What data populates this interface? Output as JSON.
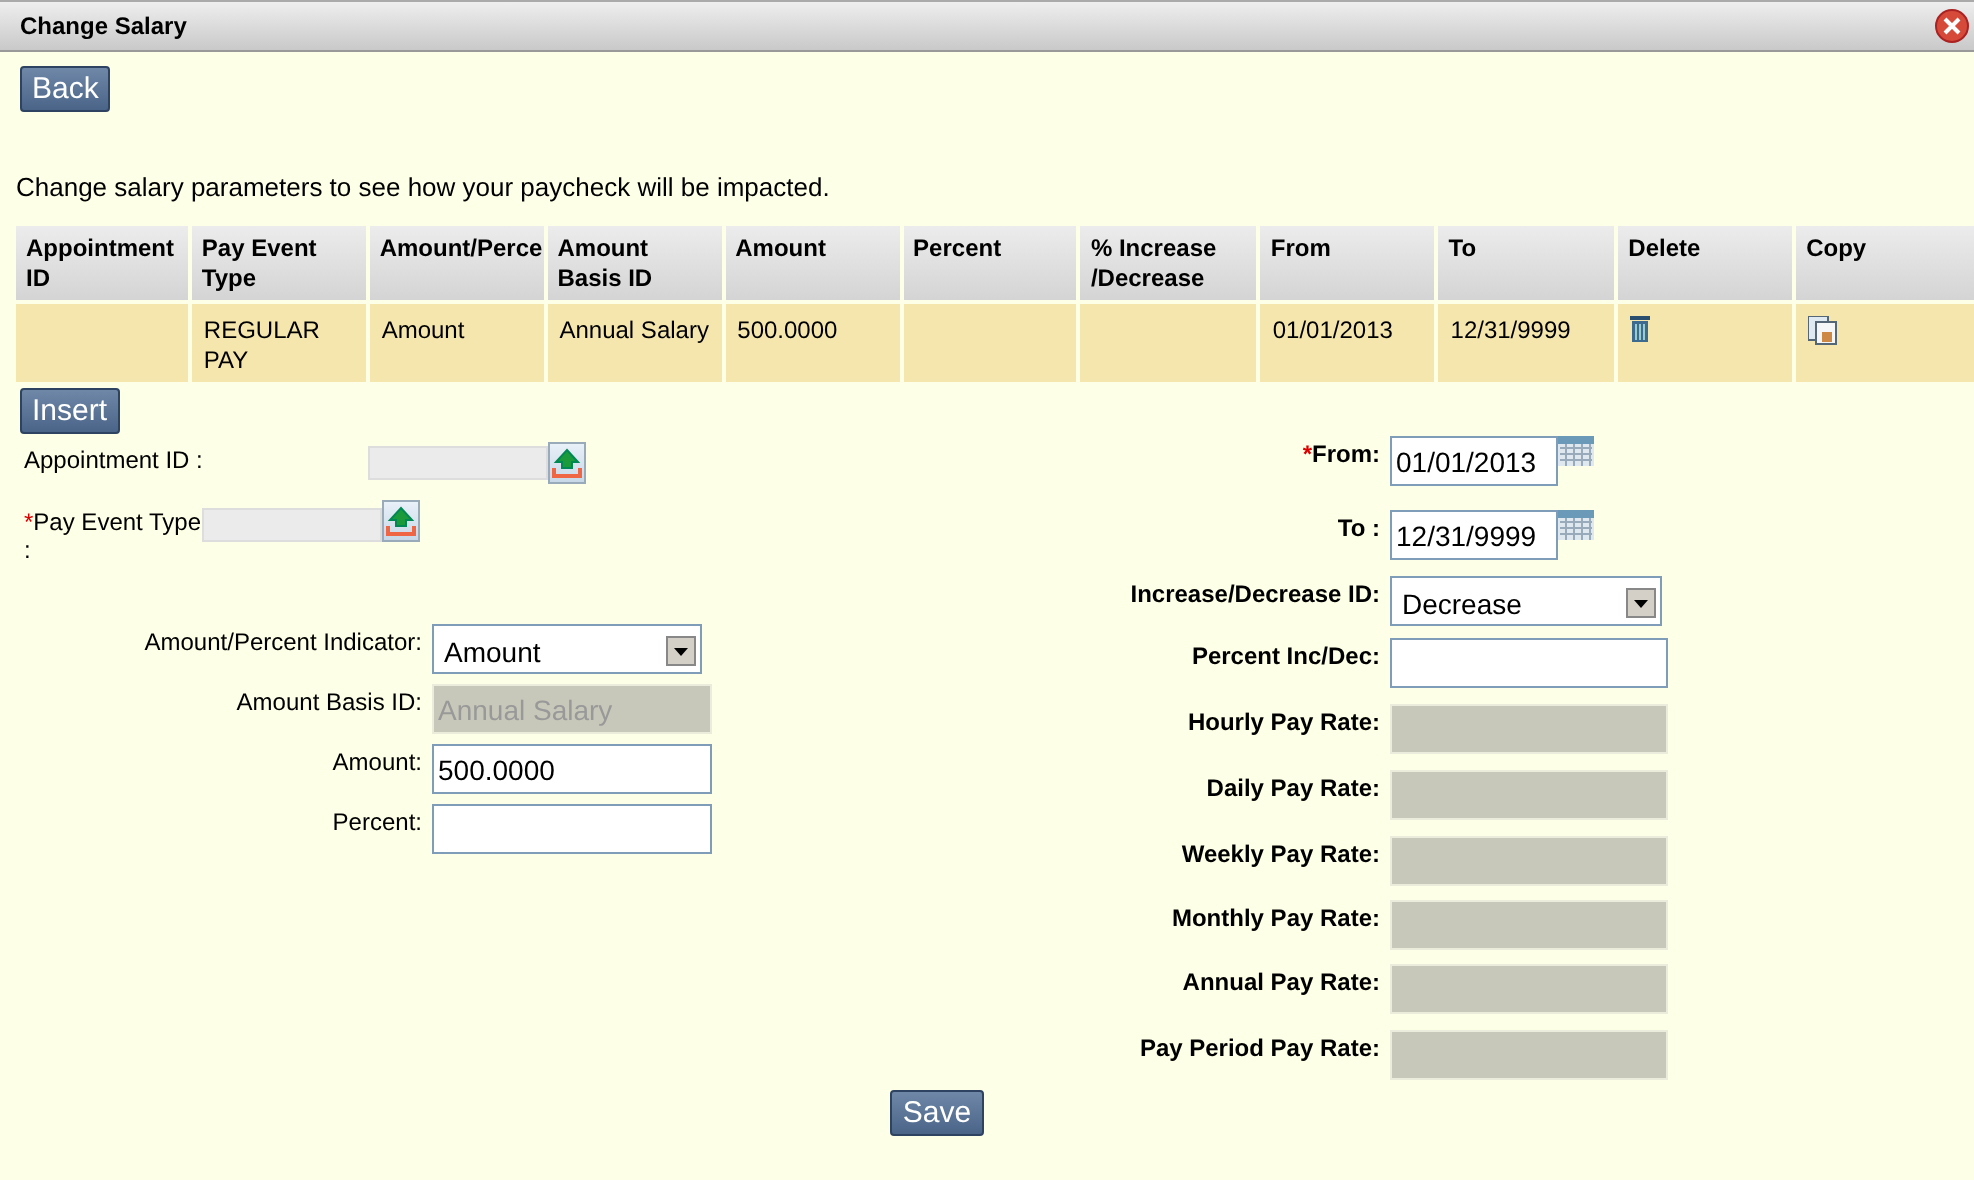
{
  "window": {
    "title": "Change Salary"
  },
  "back_button": "Back",
  "description": "Change salary parameters to see how your paycheck will be impacted.",
  "table": {
    "columns": [
      "Appointment ID",
      "Pay Event Type",
      "Amount/Perce",
      "Amount Basis ID",
      "Amount",
      "Percent",
      "% Increase /Decrease",
      "From",
      "To",
      "Delete",
      "Copy"
    ],
    "rows": [
      {
        "cells": [
          {
            "kind": "text",
            "text": ""
          },
          {
            "kind": "text",
            "text": "REGULAR PAY"
          },
          {
            "kind": "text",
            "text": "Amount"
          },
          {
            "kind": "text",
            "text": "Annual Salary"
          },
          {
            "kind": "text",
            "text": "500.0000"
          },
          {
            "kind": "text",
            "text": ""
          },
          {
            "kind": "text",
            "text": ""
          },
          {
            "kind": "text",
            "text": "01/01/2013"
          },
          {
            "kind": "text",
            "text": "12/31/9999"
          },
          {
            "kind": "delete"
          },
          {
            "kind": "copy"
          }
        ]
      }
    ]
  },
  "insert_button": "Insert",
  "left_form": [
    {
      "kind": "lookup",
      "label": "Appointment ID :"
    },
    {
      "kind": "lookup",
      "label": "Pay Event Type :",
      "marker": "*"
    },
    {
      "kind": "select",
      "label": "Amount/Percent Indicator:",
      "value": "Amount"
    },
    {
      "kind": "text",
      "label": "Amount Basis ID:",
      "placeholder": "Annual Salary",
      "disabled": true
    },
    {
      "kind": "text",
      "label": "Amount:",
      "value": "500.0000",
      "disabled": false
    },
    {
      "kind": "text",
      "label": "Percent:",
      "disabled": false
    }
  ],
  "right_form": [
    {
      "kind": "date",
      "label": "From:",
      "marker": "*",
      "value": "01/01/2013"
    },
    {
      "kind": "date",
      "label": "To :",
      "value": "12/31/9999"
    },
    {
      "kind": "select",
      "label": "Increase/Decrease ID:",
      "value": "Decrease"
    },
    {
      "kind": "text",
      "label": "Percent Inc/Dec:",
      "disabled": false
    },
    {
      "kind": "text",
      "label": "Hourly Pay Rate:",
      "disabled": true
    },
    {
      "kind": "text",
      "label": "Daily Pay Rate:",
      "disabled": true
    },
    {
      "kind": "text",
      "label": "Weekly Pay Rate:",
      "disabled": true
    },
    {
      "kind": "text",
      "label": "Monthly Pay Rate:",
      "disabled": true
    },
    {
      "kind": "text",
      "label": "Annual Pay Rate:",
      "disabled": true
    },
    {
      "kind": "text",
      "label": "Pay Period Pay Rate:",
      "disabled": true
    }
  ],
  "save_button": "Save"
}
